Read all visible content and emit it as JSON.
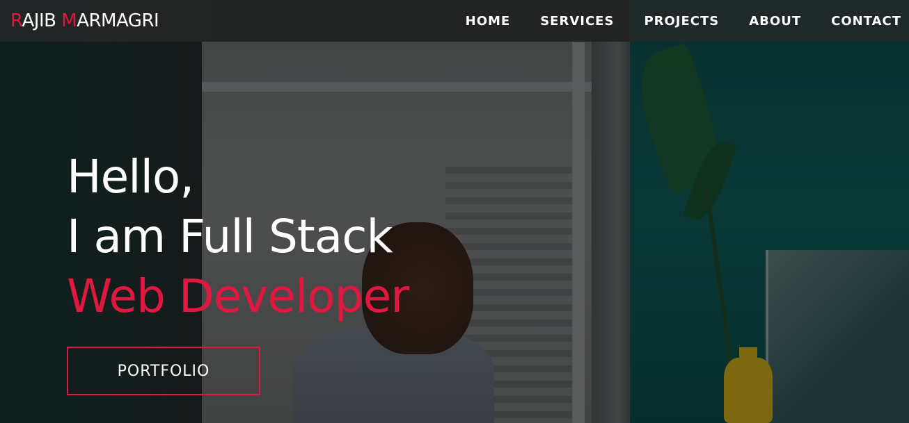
{
  "brand": {
    "first_initial": "R",
    "first_rest": "AJIB",
    "last_initial": "M",
    "last_rest": "ARMAGRI",
    "accent_color": "#e0173f"
  },
  "nav": {
    "items": [
      {
        "label": "HOME"
      },
      {
        "label": "SERVICES"
      },
      {
        "label": "PROJECTS"
      },
      {
        "label": "ABOUT"
      },
      {
        "label": "CONTACT"
      }
    ]
  },
  "hero": {
    "line1": "Hello,",
    "line2": "I am Full Stack",
    "line3": "Web Developer",
    "button_label": "PORTFOLIO"
  }
}
